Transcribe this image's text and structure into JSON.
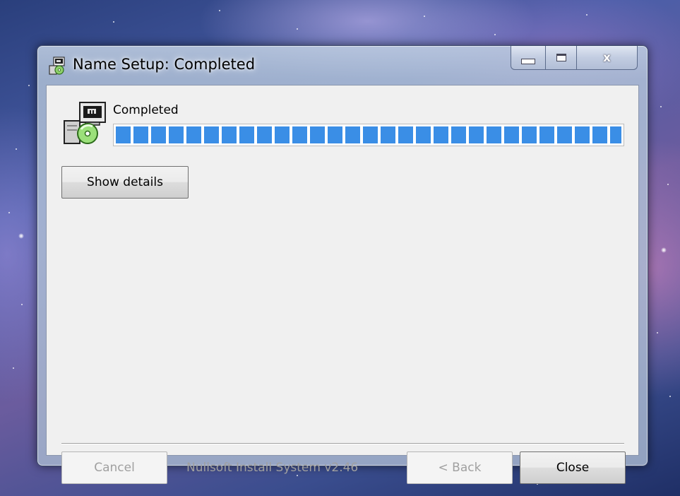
{
  "window": {
    "title": "Name Setup: Completed"
  },
  "header": {
    "status": "Completed"
  },
  "progress": {
    "percent": 100
  },
  "buttons": {
    "show_details": "Show details",
    "cancel": "Cancel",
    "back": "< Back",
    "close": "Close"
  },
  "branding": {
    "text": "Nullsoft Install System v2.46"
  },
  "colors": {
    "progress_accent": "#3a8ee6",
    "dialog_background": "#f0f0f0"
  },
  "icons": {
    "title": "installer-icon",
    "header": "installer-cd-icon",
    "minimize": "minimize-icon",
    "maximize": "maximize-icon",
    "close": "close-icon"
  }
}
